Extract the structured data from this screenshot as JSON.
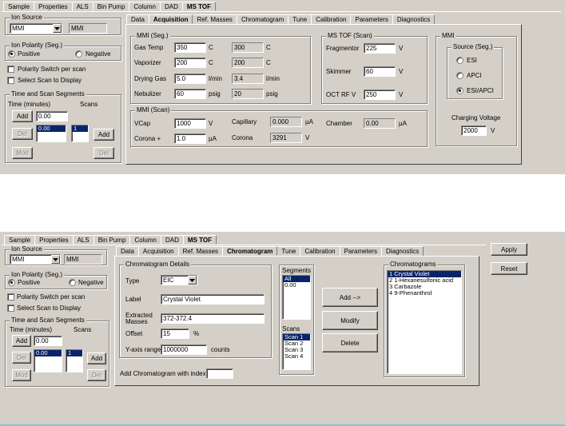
{
  "top": {
    "tabs": [
      "Sample",
      "Properties",
      "ALS",
      "Bin Pump",
      "Column",
      "DAD",
      "MS TOF"
    ],
    "ion_source": {
      "label": "Ion Source",
      "selected": "MMI",
      "readout": "MMI"
    },
    "ion_polarity": {
      "label": "Ion Polarity (Seg.)",
      "positive": "Positive",
      "negative": "Negative"
    },
    "polarity_switch": "Polarity Switch per scan",
    "select_scan": "Select Scan to Display",
    "time_scan": {
      "label": "Time and Scan Segments",
      "time_label": "Time (minutes)",
      "scans_label": "Scans",
      "add": "Add",
      "time_value": "0.00",
      "del": "Del",
      "list_value": "0.00",
      "scan_value": "1",
      "add2": "Add",
      "mod": "Mod",
      "del2": "Del"
    },
    "subtabs": [
      "Data",
      "Acquisition",
      "Ref. Masses",
      "Chromatogram",
      "Tune",
      "Calibration",
      "Parameters",
      "Diagnostics"
    ],
    "mmi_seg": {
      "label": "MMI (Seg.)",
      "rows": [
        {
          "label": "Gas Temp",
          "value": "350",
          "unit": "C",
          "actual": "300",
          "unit2": "C"
        },
        {
          "label": "Vaporizer",
          "value": "200",
          "unit": "C",
          "actual": "200",
          "unit2": "C"
        },
        {
          "label": "Drying Gas",
          "value": "5.0",
          "unit": "l/min",
          "actual": "3.4",
          "unit2": "l/min"
        },
        {
          "label": "Nebulizer",
          "value": "60",
          "unit": "psig",
          "actual": "20",
          "unit2": "psig"
        }
      ]
    },
    "ms_tof_scan": {
      "label": "MS TOF (Scan)",
      "rows": [
        {
          "label": "Fragmentor",
          "value": "225",
          "unit": "V"
        },
        {
          "label": "Skimmer",
          "value": "60",
          "unit": "V"
        },
        {
          "label": "OCT RF V",
          "value": "250",
          "unit": "V"
        }
      ]
    },
    "mmi_scan": {
      "label": "MMI (Scan)",
      "vcap_label": "VCap",
      "vcap_value": "1000",
      "vcap_unit": "V",
      "corona_label": "Corona +",
      "corona_value": "1.0",
      "corona_unit": "µA",
      "capillary_label": "Capillary",
      "capillary_value": "0.000",
      "capillary_unit": "µA",
      "corona2_label": "Corona",
      "corona2_value": "3291",
      "corona2_unit": "V",
      "chamber_label": "Chamber",
      "chamber_value": "0.00",
      "chamber_unit": "µA"
    },
    "mmi": {
      "label": "MMI",
      "source_label": "Source (Seg.)",
      "esi": "ESI",
      "apci": "APCI",
      "esiapci": "ESI/APCI",
      "charging_label": "Charging Voltage",
      "charging_value": "2000",
      "charging_unit": "V"
    }
  },
  "bottom": {
    "tabs": [
      "Sample",
      "Properties",
      "ALS",
      "Bin Pump",
      "Column",
      "DAD",
      "MS TOF"
    ],
    "apply": "Apply",
    "reset": "Reset",
    "ion_source": {
      "label": "Ion Source",
      "selected": "MMI",
      "readout": "MMI"
    },
    "ion_polarity": {
      "label": "Ion Polarity (Seg.)",
      "positive": "Positive",
      "negative": "Negative"
    },
    "polarity_switch": "Polarity Switch per scan",
    "select_scan": "Select Scan to Display",
    "time_scan": {
      "label": "Time and Scan Segments",
      "time_label": "Time (minutes)",
      "scans_label": "Scans",
      "add": "Add",
      "time_value": "0.00",
      "del": "Del",
      "list_value": "0.00",
      "scan_value": "1",
      "add2": "Add",
      "mod": "Mod",
      "del2": "Del"
    },
    "subtabs": [
      "Data",
      "Acquisition",
      "Ref. Masses",
      "Chromatogram",
      "Tune",
      "Calibration",
      "Parameters",
      "Diagnostics"
    ],
    "chrom": {
      "label": "Chromatogram Details",
      "type_label": "Type",
      "type_value": "EIC",
      "label_label": "Label",
      "label_value": "Crystal Violet",
      "masses_label": "Extracted Masses",
      "masses_value": "372-372.4",
      "offset_label": "Offset",
      "offset_value": "15",
      "offset_unit": "%",
      "yaxis_label": "Y-axis range",
      "yaxis_value": "1000000",
      "yaxis_unit": "counts"
    },
    "add_index_label": "Add Chromatogram with index",
    "segments": {
      "label": "Segments",
      "items": [
        "All",
        "0.00"
      ]
    },
    "scans": {
      "label": "Scans",
      "items": [
        "Scan 1",
        "Scan 2",
        "Scan 3",
        "Scan 4"
      ]
    },
    "buttons": {
      "add": "Add -->",
      "modify": "Modify",
      "delete": "Delete"
    },
    "chromatograms": {
      "label": "Chromatograms",
      "items": [
        "1 Crystal Violet",
        "2 1-Hexanesulfonic acid",
        "3 Carbazole",
        "4 9-Phenanthrol"
      ]
    }
  }
}
